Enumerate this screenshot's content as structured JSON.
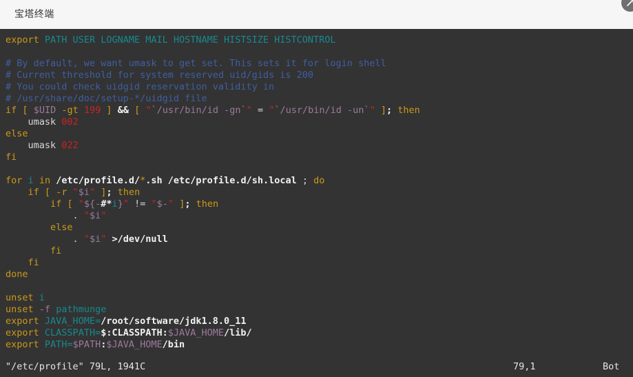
{
  "window": {
    "title": "宝塔终端",
    "expand_button_name": "expand-window-button",
    "expand_icon": "arrow-expand-icon",
    "header_bg": "#f6f6f6",
    "terminal_bg": "#333333"
  },
  "colors": {
    "keyword": "#cc9a18",
    "variable": "#18898e",
    "comment": "#3f5fa2",
    "string": "#cc2222",
    "number": "#cc2222",
    "dollar_var": "#9c7a9c",
    "path": "#f2f2f2",
    "plain": "#d8d8d8"
  },
  "terminal": {
    "program": "vim",
    "lines": [
      {
        "text": "export PATH USER LOGNAME MAIL HOSTNAME HISTSIZE HISTCONTROL",
        "tokens": [
          {
            "t": "export",
            "c": "kw"
          },
          {
            "t": " ",
            "c": "pln"
          },
          {
            "t": "PATH USER LOGNAME MAIL HOSTNAME HISTSIZE HISTCONTROL",
            "c": "var"
          }
        ]
      },
      {
        "text": "",
        "tokens": []
      },
      {
        "text": "# By default, we want umask to get set. This sets it for login shell",
        "tokens": [
          {
            "t": "# By default, we want umask to get set. This sets it for login shell",
            "c": "cmt"
          }
        ]
      },
      {
        "text": "# Current threshold for system reserved uid/gids is 200",
        "tokens": [
          {
            "t": "# Current threshold for system reserved uid/gids is 200",
            "c": "cmt"
          }
        ]
      },
      {
        "text": "# You could check uidgid reservation validity in",
        "tokens": [
          {
            "t": "# You could check uidgid reservation validity in",
            "c": "cmt"
          }
        ]
      },
      {
        "text": "# /usr/share/doc/setup-*/uidgid file",
        "tokens": [
          {
            "t": "# /usr/share/doc/setup-*/uidgid file",
            "c": "cmt"
          }
        ]
      },
      {
        "text": "if [ $UID -gt 199 ] && [ \"`/usr/bin/id -gn`\" = \"`/usr/bin/id -un`\" ]; then",
        "tokens": [
          {
            "t": "if",
            "c": "kw"
          },
          {
            "t": " ",
            "c": "pln"
          },
          {
            "t": "[",
            "c": "brk"
          },
          {
            "t": " ",
            "c": "pln"
          },
          {
            "t": "$UID",
            "c": "dvar"
          },
          {
            "t": " ",
            "c": "pln"
          },
          {
            "t": "-gt",
            "c": "kw"
          },
          {
            "t": " ",
            "c": "pln"
          },
          {
            "t": "199",
            "c": "num"
          },
          {
            "t": " ",
            "c": "pln"
          },
          {
            "t": "]",
            "c": "brk"
          },
          {
            "t": " ",
            "c": "pln"
          },
          {
            "t": "&&",
            "c": "op"
          },
          {
            "t": " ",
            "c": "pln"
          },
          {
            "t": "[",
            "c": "brk"
          },
          {
            "t": " ",
            "c": "pln"
          },
          {
            "t": "\"",
            "c": "str"
          },
          {
            "t": "`/usr/bin/id -gn`",
            "c": "dvar"
          },
          {
            "t": "\"",
            "c": "str"
          },
          {
            "t": " ",
            "c": "pln"
          },
          {
            "t": "=",
            "c": "pln"
          },
          {
            "t": " ",
            "c": "pln"
          },
          {
            "t": "\"",
            "c": "str"
          },
          {
            "t": "`/usr/bin/id -un`",
            "c": "dvar"
          },
          {
            "t": "\"",
            "c": "str"
          },
          {
            "t": " ",
            "c": "pln"
          },
          {
            "t": "]",
            "c": "brk"
          },
          {
            "t": ";",
            "c": "op"
          },
          {
            "t": " ",
            "c": "pln"
          },
          {
            "t": "then",
            "c": "kw"
          }
        ]
      },
      {
        "text": "    umask 002",
        "tokens": [
          {
            "t": "    umask ",
            "c": "pln"
          },
          {
            "t": "002",
            "c": "num"
          }
        ]
      },
      {
        "text": "else",
        "tokens": [
          {
            "t": "else",
            "c": "kw"
          }
        ]
      },
      {
        "text": "    umask 022",
        "tokens": [
          {
            "t": "    umask ",
            "c": "pln"
          },
          {
            "t": "022",
            "c": "num"
          }
        ]
      },
      {
        "text": "fi",
        "tokens": [
          {
            "t": "fi",
            "c": "kw"
          }
        ]
      },
      {
        "text": "",
        "tokens": []
      },
      {
        "text": "for i in /etc/profile.d/*.sh /etc/profile.d/sh.local ; do",
        "tokens": [
          {
            "t": "for",
            "c": "kw"
          },
          {
            "t": " ",
            "c": "pln"
          },
          {
            "t": "i",
            "c": "var"
          },
          {
            "t": " ",
            "c": "pln"
          },
          {
            "t": "in",
            "c": "kw"
          },
          {
            "t": " ",
            "c": "pln"
          },
          {
            "t": "/etc/profile.d/",
            "c": "pth"
          },
          {
            "t": "*",
            "c": "kw"
          },
          {
            "t": ".sh /etc/profile.d/sh.local",
            "c": "pth"
          },
          {
            "t": " ",
            "c": "pln"
          },
          {
            "t": ";",
            "c": "pln"
          },
          {
            "t": " ",
            "c": "pln"
          },
          {
            "t": "do",
            "c": "kw"
          }
        ]
      },
      {
        "text": "    if [ -r \"$i\" ]; then",
        "tokens": [
          {
            "t": "    ",
            "c": "pln"
          },
          {
            "t": "if",
            "c": "kw"
          },
          {
            "t": " ",
            "c": "pln"
          },
          {
            "t": "[",
            "c": "brk"
          },
          {
            "t": " ",
            "c": "pln"
          },
          {
            "t": "-r",
            "c": "kw"
          },
          {
            "t": " ",
            "c": "pln"
          },
          {
            "t": "\"",
            "c": "str"
          },
          {
            "t": "$i",
            "c": "dvar"
          },
          {
            "t": "\"",
            "c": "str"
          },
          {
            "t": " ",
            "c": "pln"
          },
          {
            "t": "]",
            "c": "brk"
          },
          {
            "t": ";",
            "c": "op"
          },
          {
            "t": " ",
            "c": "pln"
          },
          {
            "t": "then",
            "c": "kw"
          }
        ]
      },
      {
        "text": "        if [ \"${-#*i}\" != \"$-\" ]; then",
        "tokens": [
          {
            "t": "        ",
            "c": "pln"
          },
          {
            "t": "if",
            "c": "kw"
          },
          {
            "t": " ",
            "c": "pln"
          },
          {
            "t": "[",
            "c": "brk"
          },
          {
            "t": " ",
            "c": "pln"
          },
          {
            "t": "\"",
            "c": "str"
          },
          {
            "t": "${-",
            "c": "dvar"
          },
          {
            "t": "#",
            "c": "op"
          },
          {
            "t": "*",
            "c": "op"
          },
          {
            "t": "i",
            "c": "var"
          },
          {
            "t": "}",
            "c": "dvar"
          },
          {
            "t": "\"",
            "c": "str"
          },
          {
            "t": " ",
            "c": "pln"
          },
          {
            "t": "!=",
            "c": "pln"
          },
          {
            "t": " ",
            "c": "pln"
          },
          {
            "t": "\"",
            "c": "str"
          },
          {
            "t": "$-",
            "c": "dvar"
          },
          {
            "t": "\"",
            "c": "str"
          },
          {
            "t": " ",
            "c": "pln"
          },
          {
            "t": "]",
            "c": "brk"
          },
          {
            "t": ";",
            "c": "op"
          },
          {
            "t": " ",
            "c": "pln"
          },
          {
            "t": "then",
            "c": "kw"
          }
        ]
      },
      {
        "text": "            . \"$i\"",
        "tokens": [
          {
            "t": "            ",
            "c": "pln"
          },
          {
            "t": ".",
            "c": "pln"
          },
          {
            "t": " ",
            "c": "pln"
          },
          {
            "t": "\"",
            "c": "str"
          },
          {
            "t": "$i",
            "c": "dvar"
          },
          {
            "t": "\"",
            "c": "str"
          }
        ]
      },
      {
        "text": "        else",
        "tokens": [
          {
            "t": "        ",
            "c": "pln"
          },
          {
            "t": "else",
            "c": "kw"
          }
        ]
      },
      {
        "text": "            . \"$i\" >/dev/null",
        "tokens": [
          {
            "t": "            ",
            "c": "pln"
          },
          {
            "t": ".",
            "c": "pln"
          },
          {
            "t": " ",
            "c": "pln"
          },
          {
            "t": "\"",
            "c": "str"
          },
          {
            "t": "$i",
            "c": "dvar"
          },
          {
            "t": "\"",
            "c": "str"
          },
          {
            "t": " ",
            "c": "pln"
          },
          {
            "t": ">",
            "c": "op"
          },
          {
            "t": "/dev/null",
            "c": "pth"
          }
        ]
      },
      {
        "text": "        fi",
        "tokens": [
          {
            "t": "        ",
            "c": "pln"
          },
          {
            "t": "fi",
            "c": "kw"
          }
        ]
      },
      {
        "text": "    fi",
        "tokens": [
          {
            "t": "    ",
            "c": "pln"
          },
          {
            "t": "fi",
            "c": "kw"
          }
        ]
      },
      {
        "text": "done",
        "tokens": [
          {
            "t": "done",
            "c": "kw"
          }
        ]
      },
      {
        "text": "",
        "tokens": []
      },
      {
        "text": "unset i",
        "tokens": [
          {
            "t": "unset",
            "c": "kw"
          },
          {
            "t": " ",
            "c": "pln"
          },
          {
            "t": "i",
            "c": "var"
          }
        ]
      },
      {
        "text": "unset -f pathmunge",
        "tokens": [
          {
            "t": "unset",
            "c": "kw"
          },
          {
            "t": " ",
            "c": "pln"
          },
          {
            "t": "-f",
            "c": "dvar"
          },
          {
            "t": " ",
            "c": "pln"
          },
          {
            "t": "pathmunge",
            "c": "var"
          }
        ]
      },
      {
        "text": "export JAVA_HOME=/root/software/jdk1.8.0_11",
        "tokens": [
          {
            "t": "export",
            "c": "kw"
          },
          {
            "t": " ",
            "c": "pln"
          },
          {
            "t": "JAVA_HOME",
            "c": "var"
          },
          {
            "t": "=",
            "c": "var"
          },
          {
            "t": "/root/software/jdk1.8.0_11",
            "c": "pth"
          }
        ]
      },
      {
        "text": "export CLASSPATH=$:CLASSPATH:$JAVA_HOME/lib/",
        "tokens": [
          {
            "t": "export",
            "c": "kw"
          },
          {
            "t": " ",
            "c": "pln"
          },
          {
            "t": "CLASSPATH",
            "c": "var"
          },
          {
            "t": "=",
            "c": "var"
          },
          {
            "t": "$:CLASSPATH:",
            "c": "pth"
          },
          {
            "t": "$JAVA_HOME",
            "c": "dvar"
          },
          {
            "t": "/lib/",
            "c": "pth"
          }
        ]
      },
      {
        "text": "export PATH=$PATH:$JAVA_HOME/bin",
        "tokens": [
          {
            "t": "export",
            "c": "kw"
          },
          {
            "t": " ",
            "c": "pln"
          },
          {
            "t": "PATH",
            "c": "var"
          },
          {
            "t": "=",
            "c": "var"
          },
          {
            "t": "$PATH",
            "c": "dvar"
          },
          {
            "t": ":",
            "c": "pth"
          },
          {
            "t": "$JAVA_HOME",
            "c": "dvar"
          },
          {
            "t": "/bin",
            "c": "pth"
          }
        ]
      }
    ],
    "status": {
      "file": "\"/etc/profile\" 79L, 1941C",
      "position": "79,1",
      "scroll": "Bot"
    }
  }
}
